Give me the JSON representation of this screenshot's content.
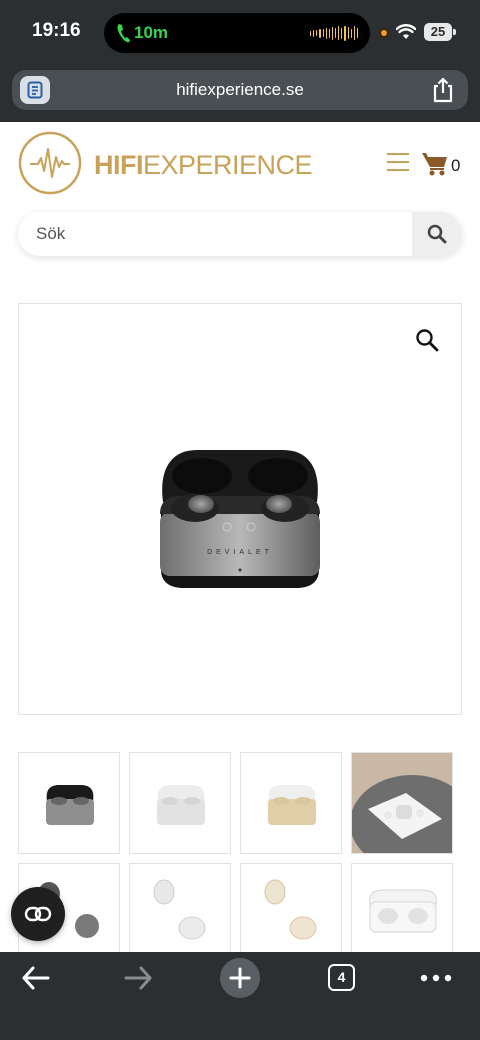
{
  "status_bar": {
    "time": "19:16",
    "call_duration": "10m",
    "battery": "25"
  },
  "browser": {
    "url": "hifiexperience.se",
    "tab_count": "4"
  },
  "site": {
    "logo_part1": "HIFI",
    "logo_part2": "EXPERIENCE",
    "cart_count": "0",
    "brand_color": "#c9a25a"
  },
  "search": {
    "placeholder": "Sök"
  },
  "product": {
    "case_print": "DEVIALET",
    "thumbnails": [
      "black earbuds in case",
      "white earbuds in case",
      "white and gold earbuds in case",
      "lifestyle photo on table",
      "single black earbuds",
      "single white earbuds",
      "single white and gold earbuds",
      "open white case"
    ]
  },
  "icons": {
    "search": "search-icon",
    "zoom": "magnifier-icon",
    "cart": "cart-icon",
    "menu": "hamburger-menu-icon",
    "share": "share-icon"
  }
}
